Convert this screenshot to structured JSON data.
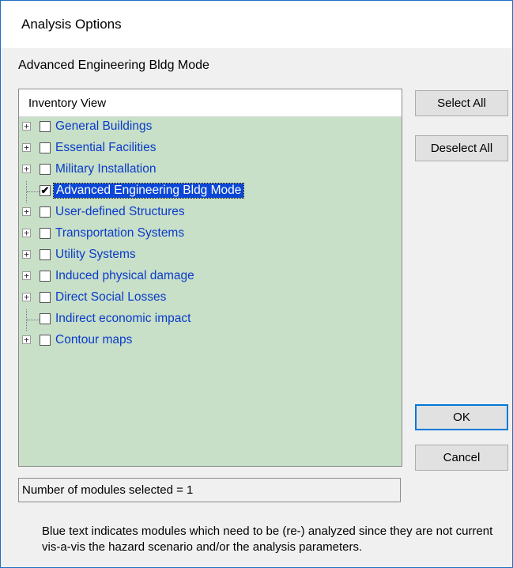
{
  "window": {
    "title": "Analysis Options"
  },
  "subtitle": "Advanced Engineering Bldg Mode",
  "tree": {
    "header": "Inventory View",
    "items": [
      {
        "label": "General Buildings",
        "checked": false,
        "expandable": true,
        "selected": false
      },
      {
        "label": "Essential Facilities",
        "checked": false,
        "expandable": true,
        "selected": false
      },
      {
        "label": "Military Installation",
        "checked": false,
        "expandable": true,
        "selected": false
      },
      {
        "label": "Advanced Engineering Bldg Mode",
        "checked": true,
        "expandable": false,
        "selected": true
      },
      {
        "label": "User-defined Structures",
        "checked": false,
        "expandable": true,
        "selected": false
      },
      {
        "label": "Transportation Systems",
        "checked": false,
        "expandable": true,
        "selected": false
      },
      {
        "label": "Utility Systems",
        "checked": false,
        "expandable": true,
        "selected": false
      },
      {
        "label": "Induced physical damage",
        "checked": false,
        "expandable": true,
        "selected": false
      },
      {
        "label": "Direct Social Losses",
        "checked": false,
        "expandable": true,
        "selected": false
      },
      {
        "label": "Indirect economic impact",
        "checked": false,
        "expandable": false,
        "selected": false
      },
      {
        "label": "Contour maps",
        "checked": false,
        "expandable": true,
        "selected": false
      }
    ]
  },
  "buttons": {
    "select_all": "Select All",
    "deselect_all": "Deselect All",
    "ok": "OK",
    "cancel": "Cancel"
  },
  "status": "Number of modules selected = 1",
  "note": "Blue text indicates modules which need to be (re-) analyzed since they are not current vis-a-vis the hazard scenario and/or the analysis parameters.",
  "colors": {
    "tree_background": "#c8dfc8",
    "module_text": "#0a3cc9",
    "selection": "#0b47d6",
    "window_border": "#1f6fc3"
  },
  "icons": {
    "expander": "plus-box-icon",
    "checkbox": "checkbox-icon",
    "check": "checkmark-icon"
  }
}
